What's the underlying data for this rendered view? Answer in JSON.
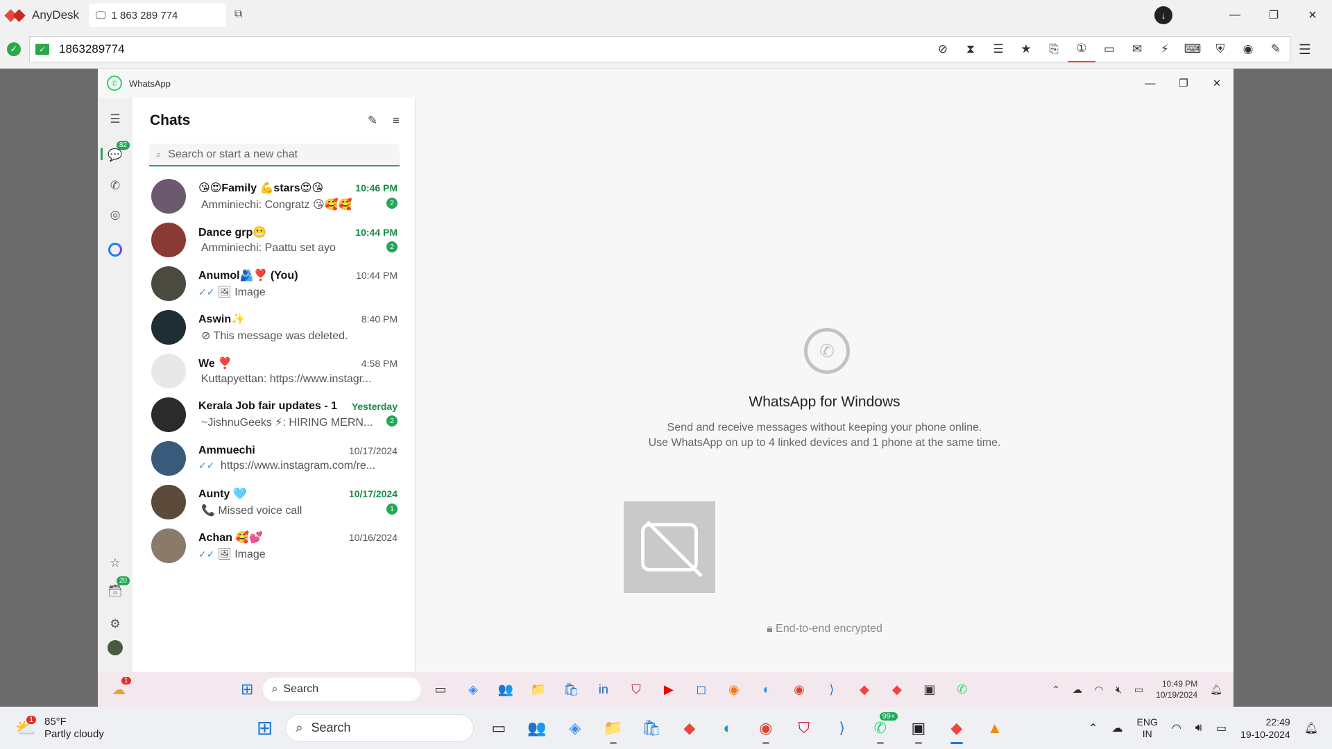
{
  "anydesk": {
    "app_name": "AnyDesk",
    "tab_label": "1 863 289 774",
    "address": "1863289774",
    "user_initial": "↓"
  },
  "whatsapp": {
    "window_title": "WhatsApp",
    "rail_badges": {
      "chats": "82",
      "archived": "20"
    },
    "list_title": "Chats",
    "search_placeholder": "Search or start a new chat",
    "chats": [
      {
        "name": "😘😍Family 💪stars😍😘",
        "time": "10:46 PM",
        "time_unread": true,
        "preview": "Amminiechi: Congratz 😘🥰🥰",
        "badge": "2",
        "avatar_color": "#6b5a6e",
        "ticks": "",
        "media_icon": ""
      },
      {
        "name": "Dance grp😬",
        "time": "10:44 PM",
        "time_unread": true,
        "preview": "Amminiechi: Paattu set ayo",
        "badge": "2",
        "avatar_color": "#8a3a35",
        "ticks": "",
        "media_icon": ""
      },
      {
        "name": "Anumol🫂❣️ (You)",
        "time": "10:44 PM",
        "time_unread": false,
        "preview": "Image",
        "badge": "",
        "avatar_color": "#4a4a40",
        "ticks": "✓✓",
        "media_icon": "🖼"
      },
      {
        "name": "Aswin✨",
        "time": "8:40 PM",
        "time_unread": false,
        "preview": "This message was deleted.",
        "badge": "",
        "avatar_color": "#1f2e35",
        "ticks": "",
        "media_icon": "⊘"
      },
      {
        "name": "We ❣️",
        "time": "4:58 PM",
        "time_unread": false,
        "preview": "Kuttapyettan: https://www.instagr...",
        "badge": "",
        "avatar_color": "#e8e8e8",
        "ticks": "",
        "media_icon": ""
      },
      {
        "name": "Kerala Job fair updates - 1",
        "time": "Yesterday",
        "time_unread": true,
        "preview": "~JishnuGeeks ⚡: HIRING MERN...",
        "badge": "2",
        "avatar_color": "#2b2b2b",
        "ticks": "",
        "media_icon": ""
      },
      {
        "name": "Ammuechi",
        "time": "10/17/2024",
        "time_unread": false,
        "preview": "https://www.instagram.com/re...",
        "badge": "",
        "avatar_color": "#3a5a7a",
        "ticks": "✓✓",
        "media_icon": ""
      },
      {
        "name": "Aunty 🩵",
        "time": "10/17/2024",
        "time_unread": true,
        "preview": "Missed voice call",
        "badge": "1",
        "avatar_color": "#5a4a3a",
        "ticks": "",
        "media_icon": "📞"
      },
      {
        "name": "Achan 🥰💕",
        "time": "10/16/2024",
        "time_unread": false,
        "preview": "Image",
        "badge": "",
        "avatar_color": "#8a7a6a",
        "ticks": "✓✓",
        "media_icon": "🖼"
      }
    ],
    "intro_title": "WhatsApp for Windows",
    "intro_line1": "Send and receive messages without keeping your phone online.",
    "intro_line2": "Use WhatsApp on up to 4 linked devices and 1 phone at the same time.",
    "e2e": "End-to-end encrypted"
  },
  "remote_taskbar": {
    "weather_badge": "1",
    "search_label": "Search",
    "time": "10:49 PM",
    "date": "10/19/2024",
    "apps": [
      "file-explorer",
      "copilot",
      "teams",
      "folder",
      "store",
      "linkedin",
      "mcafee",
      "youtube",
      "outlook",
      "firefox",
      "edge",
      "chrome",
      "vscode",
      "anydesk",
      "anydesk-2",
      "terminal",
      "whatsapp"
    ]
  },
  "host_taskbar": {
    "temperature": "85°F",
    "condition": "Partly cloudy",
    "weather_badge": "1",
    "search_label": "Search",
    "whatsapp_badge": "99+",
    "lang_line1": "ENG",
    "lang_line2": "IN",
    "time": "22:49",
    "date": "19-10-2024"
  }
}
